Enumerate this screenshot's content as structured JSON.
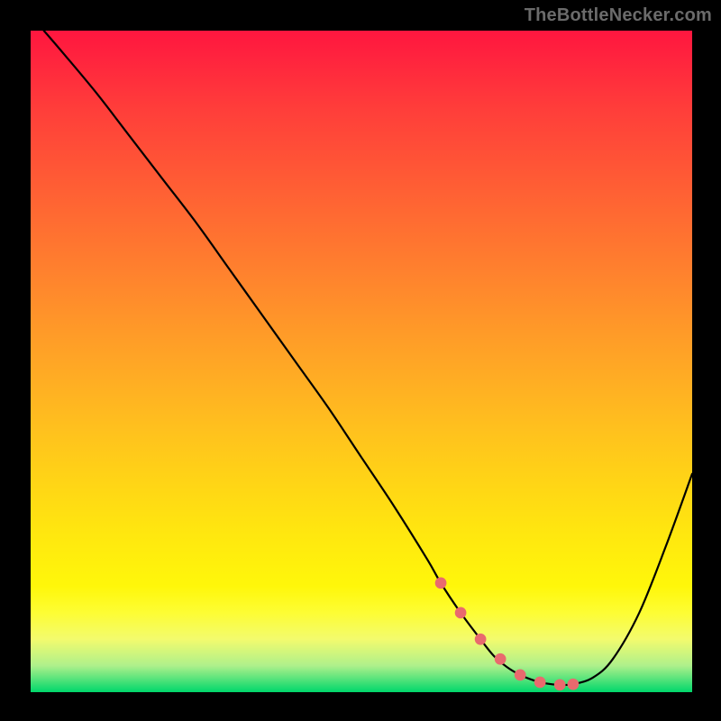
{
  "watermark": "TheBottleNecker.com",
  "colors": {
    "background": "#000000",
    "curve": "#000000",
    "marker": "#e96a6e",
    "watermark_text": "#6b6b6b"
  },
  "chart_data": {
    "type": "line",
    "title": "",
    "xlabel": "",
    "ylabel": "",
    "xlim": [
      0,
      100
    ],
    "ylim": [
      0,
      100
    ],
    "grid": false,
    "legend": false,
    "series": [
      {
        "name": "bottleneck-curve",
        "x": [
          2,
          5,
          10,
          15,
          20,
          25,
          30,
          35,
          40,
          45,
          50,
          55,
          60,
          62,
          65,
          68,
          70,
          72,
          74,
          76,
          78,
          80,
          82,
          85,
          88,
          92,
          96,
          100
        ],
        "values": [
          100,
          96.5,
          90.5,
          84,
          77.5,
          71,
          64,
          57,
          50,
          43,
          35.5,
          28,
          20,
          16.5,
          12,
          8,
          5.5,
          3.8,
          2.6,
          1.8,
          1.3,
          1.1,
          1.2,
          2.2,
          5,
          12,
          22,
          33
        ],
        "color": "#000000"
      }
    ],
    "annotations": {
      "trough_markers": {
        "x": [
          62,
          65,
          68,
          71,
          74,
          77,
          80,
          82
        ],
        "values": [
          16.5,
          12,
          8,
          5,
          2.6,
          1.5,
          1.1,
          1.2
        ],
        "color": "#e96a6e",
        "radius_frac": 0.008
      }
    },
    "background_gradient": {
      "top": "#ff163f",
      "bottom": "#00d76b",
      "direction": "vertical"
    }
  }
}
